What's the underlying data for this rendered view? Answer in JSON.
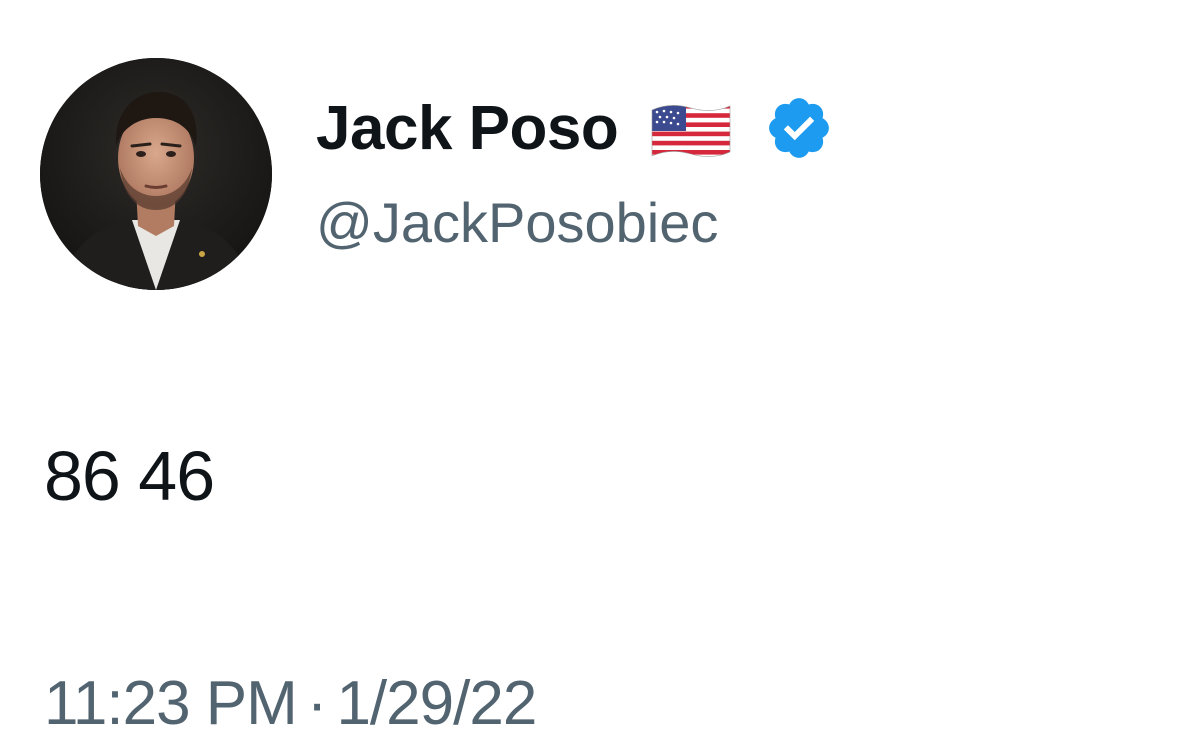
{
  "tweet": {
    "author": {
      "display_name": "Jack Poso",
      "flag_emoji_icon": "us-flag-icon",
      "verified_icon": "verified-badge-icon",
      "handle": "@JackPosobiec",
      "avatar_icon": "profile-avatar"
    },
    "text": "86 46",
    "time": "11:23 PM",
    "separator": "·",
    "date": "1/29/22"
  },
  "colors": {
    "primary_text": "#0f1419",
    "secondary_text": "#536471",
    "verified_blue": "#1d9bf0",
    "background": "#ffffff"
  }
}
